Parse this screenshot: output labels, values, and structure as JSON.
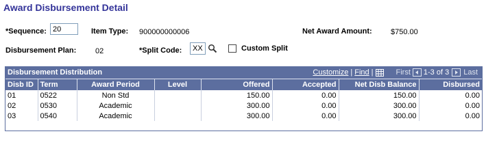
{
  "page": {
    "title": "Award Disbursement Detail"
  },
  "form": {
    "sequence_label": "*Sequence:",
    "sequence_value": "20",
    "item_type_label": "Item Type:",
    "item_type_value": "900000000006",
    "net_award_label": "Net Award Amount:",
    "net_award_value": "$750.00",
    "plan_label": "Disbursement Plan:",
    "plan_value": "02",
    "split_code_label": "*Split Code:",
    "split_code_value": "XX",
    "custom_split_label": "Custom Split",
    "custom_split_checked": false
  },
  "grid": {
    "title": "Disbursement Distribution",
    "customize": "Customize",
    "find": "Find",
    "first": "First",
    "range": "1-3 of 3",
    "last": "Last",
    "columns": [
      "Disb ID",
      "Term",
      "Award Period",
      "Level",
      "Offered",
      "Accepted",
      "Net Disb Balance",
      "Disbursed"
    ],
    "rows": [
      [
        "01",
        "0522",
        "Non Std",
        "",
        "150.00",
        "0.00",
        "150.00",
        "0.00"
      ],
      [
        "02",
        "0530",
        "Academic",
        "",
        "300.00",
        "0.00",
        "300.00",
        "0.00"
      ],
      [
        "03",
        "0540",
        "Academic",
        "",
        "300.00",
        "0.00",
        "300.00",
        "0.00"
      ]
    ]
  }
}
